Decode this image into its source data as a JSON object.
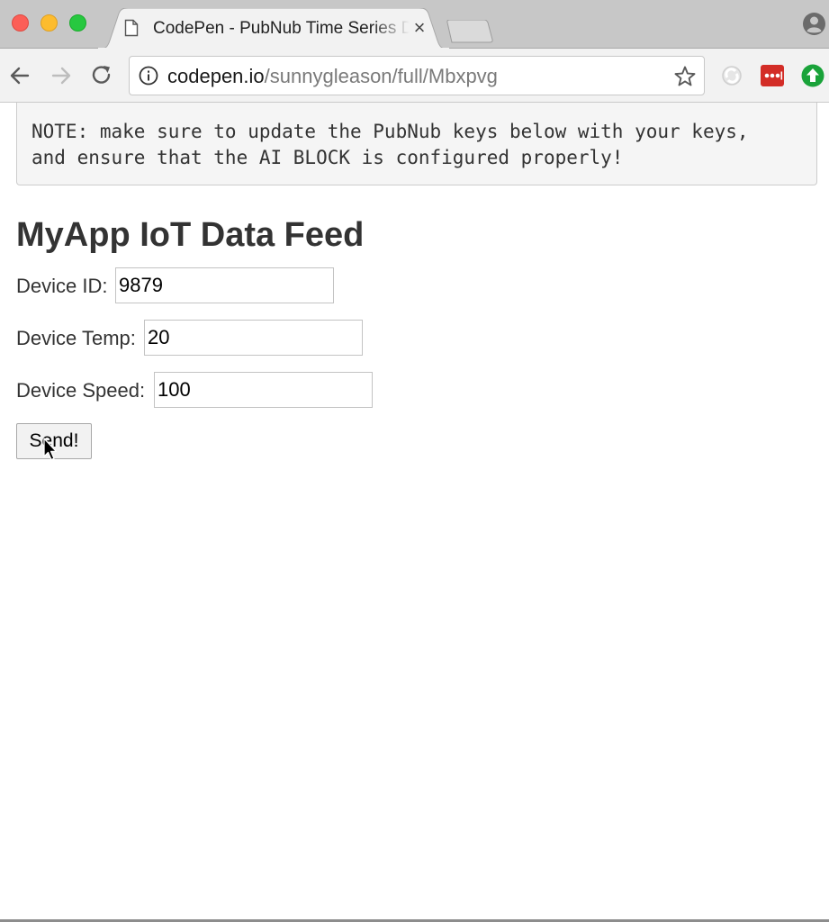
{
  "browser": {
    "tab": {
      "title": "CodePen - PubNub Time Series Dashboard",
      "close_glyph": "×",
      "icon": "page-icon"
    },
    "address_bar": {
      "host": "codepen.io",
      "path": "/sunnygleason/full/Mbxpvg",
      "icon": "info-icon"
    },
    "nav_icons": [
      "back-arrow-icon",
      "forward-arrow-icon",
      "reload-icon"
    ],
    "extensions": [
      "sync-extension-icon",
      "lastpass-icon",
      "upload-extension-icon"
    ],
    "colors": {
      "tl_close": "#fc5f57",
      "tl_minimize": "#fdbc2e",
      "tl_maximize": "#27c840",
      "lastpass": "#d32d27",
      "upload_ext": "#1aa33a"
    }
  },
  "note": {
    "line1": "NOTE: make sure to update the PubNub keys below with your keys,",
    "line2": "and ensure that the AI BLOCK is configured properly!"
  },
  "app": {
    "title": "MyApp IoT Data Feed",
    "fields": {
      "device_id": {
        "label": "Device ID:",
        "value": "9879"
      },
      "device_temp": {
        "label": "Device Temp:",
        "value": "20"
      },
      "device_speed": {
        "label": "Device Speed:",
        "value": "100"
      }
    },
    "send_label": "Send!"
  }
}
